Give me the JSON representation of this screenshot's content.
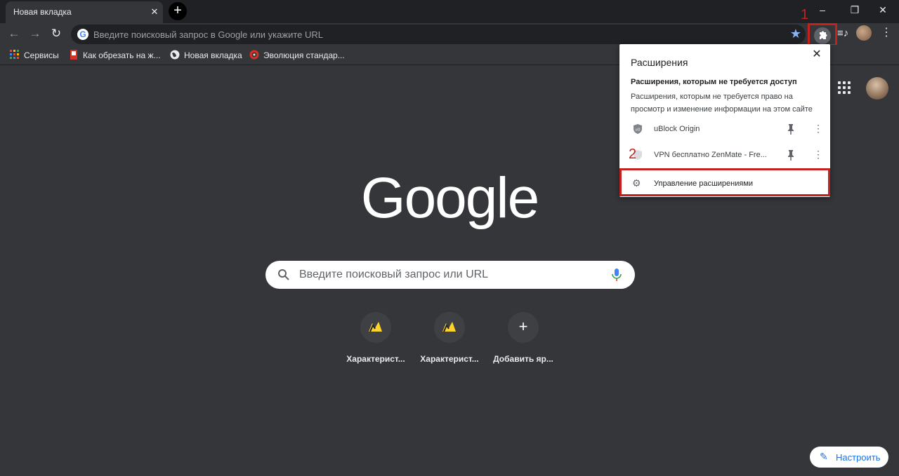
{
  "tab": {
    "title": "Новая вкладка",
    "close": "✕"
  },
  "toolbar": {
    "omnibox_placeholder": "Введите поисковый запрос в Google или укажите URL"
  },
  "markers": {
    "one": "1",
    "two": "2"
  },
  "bookmarks": [
    {
      "label": "Сервисы"
    },
    {
      "label": "Как обрезать на ж..."
    },
    {
      "label": "Новая вкладка"
    },
    {
      "label": "Эволюция стандар..."
    }
  ],
  "main": {
    "logo": "Google",
    "search_placeholder": "Введите поисковый запрос или URL",
    "shortcuts": [
      {
        "label": "Характерист..."
      },
      {
        "label": "Характерист..."
      },
      {
        "label": "Добавить яр..."
      }
    ],
    "customize_label": "Настроить"
  },
  "popup": {
    "title": "Расширения",
    "section_title": "Расширения, которым не требуется доступ",
    "section_desc": "Расширения, которым не требуется право на просмотр и изменение информации на этом сайте",
    "extensions": [
      {
        "name": "uBlock Origin"
      },
      {
        "name": "VPN бесплатно ZenMate - Fre..."
      }
    ],
    "manage_label": "Управление расширениями"
  },
  "colors": {
    "highlight": "#c5221f",
    "accent": "#1a73e8",
    "background": "#35363a"
  }
}
